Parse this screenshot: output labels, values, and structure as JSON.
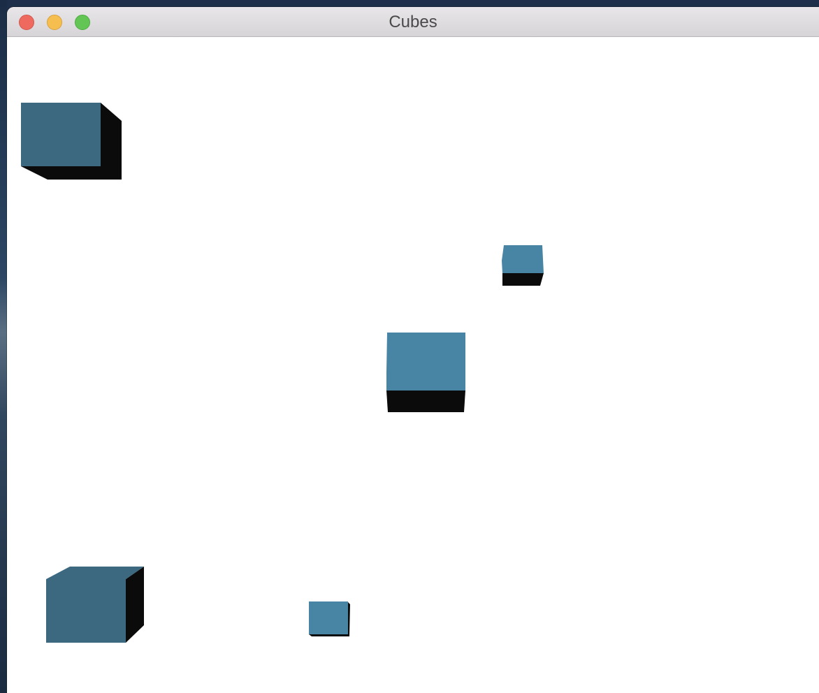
{
  "window": {
    "title": "Cubes",
    "controls": {
      "close": "close-button",
      "minimize": "minimize-button",
      "zoom": "zoom-button"
    }
  },
  "colors": {
    "traffic_close": "#ee6a5e",
    "traffic_minimize": "#f6be4f",
    "traffic_zoom": "#62c554",
    "canvas_background": "#ffffff",
    "cube_face_dark": "#3c6880",
    "cube_face_light": "#4884a3",
    "cube_side": "#0b0b0b"
  },
  "scene": {
    "cube_count": 5
  }
}
